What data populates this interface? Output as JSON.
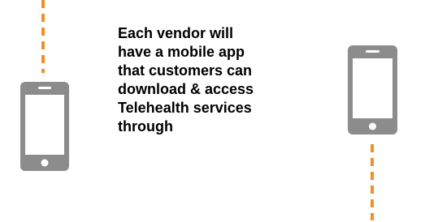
{
  "colors": {
    "connector": "#f0902c",
    "phone_body": "#8c8c8c",
    "phone_screen": "#ffffff",
    "text": "#000000"
  },
  "icons": {
    "left_phone": "smartphone-icon",
    "right_phone": "smartphone-icon"
  },
  "caption": {
    "lines": [
      "Each vendor will",
      "have a mobile app",
      "that customers can",
      "download & access",
      "Telehealth services",
      "through"
    ]
  }
}
